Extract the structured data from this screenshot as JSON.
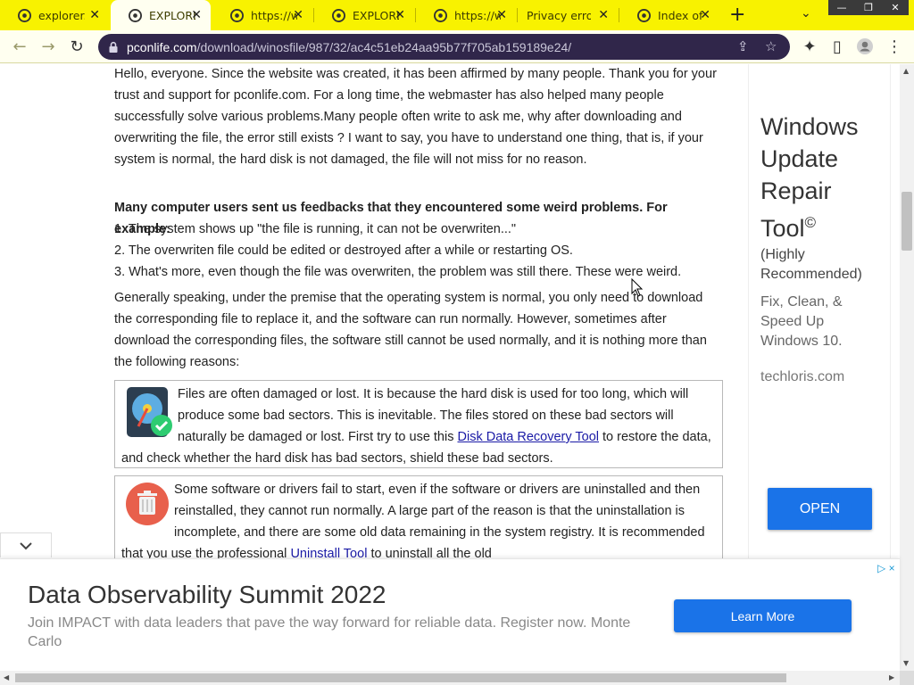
{
  "tabs": [
    {
      "title": "explorer.e",
      "active": false
    },
    {
      "title": "EXPLORE",
      "active": true
    },
    {
      "title": "https://w",
      "active": false
    },
    {
      "title": "EXPLORE",
      "active": false
    },
    {
      "title": "https://w",
      "active": false
    },
    {
      "title": "Privacy error",
      "active": false
    },
    {
      "title": "Index of",
      "active": false
    }
  ],
  "toolbar": {
    "url_host": "pconlife.com",
    "url_path": "/download/winosfile/987/32/ac4c51eb24aa95b77f705ab159189e24/"
  },
  "article": {
    "intro": "Hello, everyone. Since the website was created, it has been affirmed by many people. Thank you for your trust and support for pconlife.com. For a long time, the webmaster has also helped many people successfully solve various problems.Many people often write to ask me, why after downloading and overwriting the file, the error still exists ? I want to say, you have to understand one thing, that is, if your system is normal, the hard disk is not damaged, the file will not miss for no reason.",
    "feedback_heading": "Many computer users sent us feedbacks that they encountered some weird problems. For example:",
    "problems": [
      "1. The system shows up \"the file is running, it can not be overwriten...\"",
      "2. The overwriten file could be edited or destroyed after a while or restarting OS.",
      "3. What's more, even though the file was overwriten, the problem was still there. These were weird."
    ],
    "premise": "Generally speaking, under the premise that the operating system is normal, you only need to download the corresponding file to replace it, and the software can run normally. However, sometimes after download the corresponding files, the software still cannot be used normally, and it is nothing more than the following reasons:",
    "reason1_before": "Files are often damaged or lost. It is because the hard disk is used for too long, which will produce some bad sectors. This is inevitable. The files stored on these bad sectors will naturally be damaged or lost. First try to use this ",
    "reason1_link": "Disk Data Recovery Tool",
    "reason1_after": " to restore the data, and check whether the hard disk has bad sectors, shield these bad sectors.",
    "reason2_before": "Some software or drivers fail to start, even if the software or drivers are uninstalled and then reinstalled, they cannot run normally. A large part of the reason is that the uninstallation is incomplete, and there are some old data remaining in the system registry. It is recommended that you use the professional ",
    "reason2_link": "Uninstall Tool",
    "reason2_after": " to uninstall all the old"
  },
  "side_ad": {
    "headline": "Windows Update Repair Tool",
    "copyright": "©",
    "recommended": "(Highly Recommended)",
    "description": "Fix, Clean, & Speed Up Windows 10.",
    "domain": "techloris.com",
    "button": "OPEN"
  },
  "bottom_ad": {
    "headline": "Data Observability Summit 2022",
    "text": "Join IMPACT with data leaders that pave the way forward for reliable data. Register now. Monte Carlo",
    "button": "Learn More"
  },
  "colors": {
    "tabstrip": "#f8f200",
    "omnibox": "#30264a",
    "accent": "#1a73e8",
    "link": "#1a1aa6"
  },
  "icons": [
    "chrome-favicon",
    "close-icon",
    "plus-icon",
    "chevron-down-icon",
    "minimize-icon",
    "restore-icon",
    "back-icon",
    "forward-icon",
    "reload-icon",
    "lock-icon",
    "share-icon",
    "star-icon",
    "extensions-icon",
    "side-panel-icon",
    "profile-icon",
    "menu-icon",
    "hard-disk-icon",
    "trash-icon",
    "adchoices-icon",
    "mouse-cursor-icon"
  ]
}
